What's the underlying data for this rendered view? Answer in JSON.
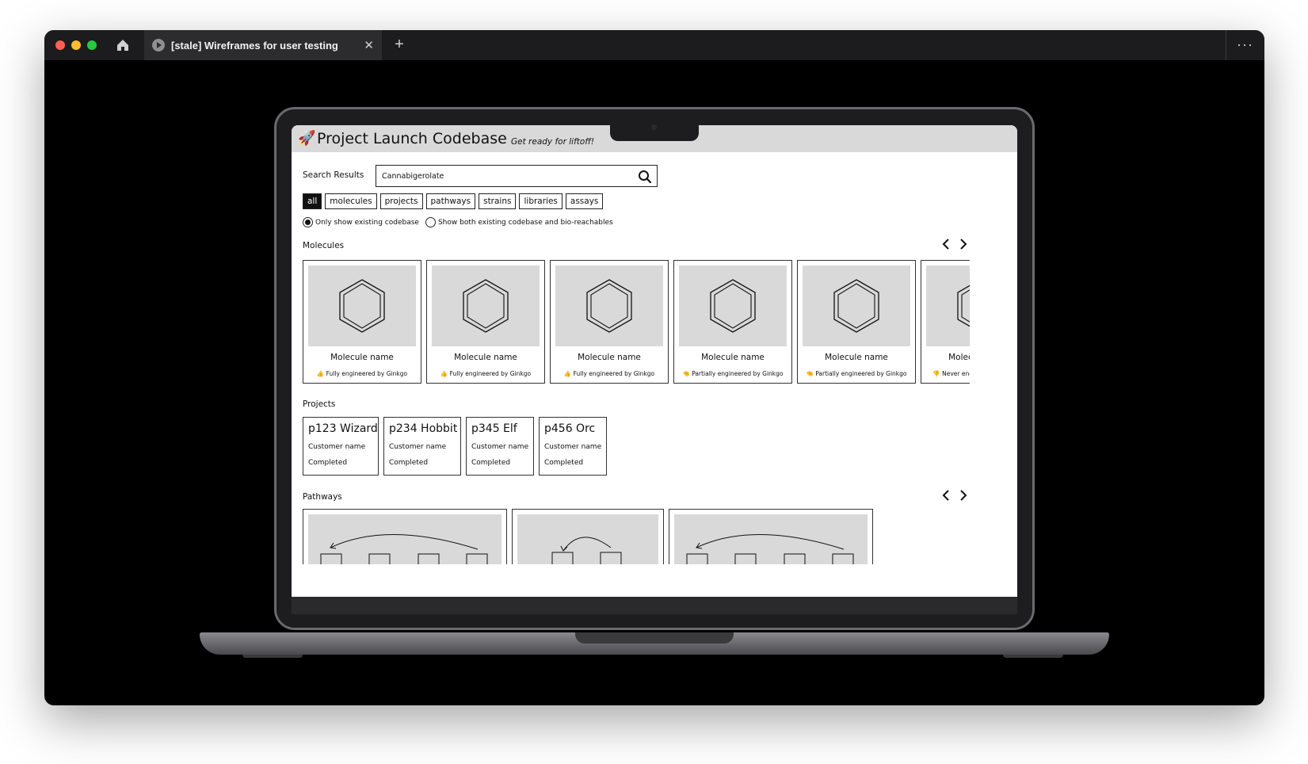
{
  "browser": {
    "tab_title": "[stale] Wireframes for user testing",
    "tab_close": "✕",
    "new_tab": "+",
    "more": "···"
  },
  "app": {
    "title": "Project Launch Codebase",
    "tagline": "Get ready for liftoff!",
    "logo_emoji": "🚀"
  },
  "search": {
    "label": "Search Results",
    "value": "Cannabigerolate"
  },
  "filters": [
    "all",
    "molecules",
    "projects",
    "pathways",
    "strains",
    "libraries",
    "assays"
  ],
  "active_filter": "all",
  "radio_options": [
    {
      "label": "Only show existing codebase",
      "selected": true
    },
    {
      "label": "Show both existing codebase and bio-reachables",
      "selected": false
    }
  ],
  "molecules": {
    "label": "Molecules",
    "items": [
      {
        "name": "Molecule name",
        "status_icon": "👍",
        "status": "Fully engineered by Ginkgo"
      },
      {
        "name": "Molecule name",
        "status_icon": "👍",
        "status": "Fully engineered by Ginkgo"
      },
      {
        "name": "Molecule name",
        "status_icon": "👍",
        "status": "Fully engineered by Ginkgo"
      },
      {
        "name": "Molecule name",
        "status_icon": "🤏",
        "status": "Partially engineered by Ginkgo"
      },
      {
        "name": "Molecule name",
        "status_icon": "🤏",
        "status": "Partially engineered by Ginkgo"
      },
      {
        "name": "Molecule name",
        "status_icon": "👎",
        "status": "Never engineered by Ginkgo"
      }
    ]
  },
  "projects": {
    "label": "Projects",
    "items": [
      {
        "title": "p123 Wizard",
        "customer": "Customer name",
        "status": "Completed"
      },
      {
        "title": "p234 Hobbit",
        "customer": "Customer name",
        "status": "Completed"
      },
      {
        "title": "p345 Elf",
        "customer": "Customer name",
        "status": "Completed"
      },
      {
        "title": "p456 Orc",
        "customer": "Customer name",
        "status": "Completed"
      }
    ]
  },
  "pathways": {
    "label": "Pathways"
  }
}
